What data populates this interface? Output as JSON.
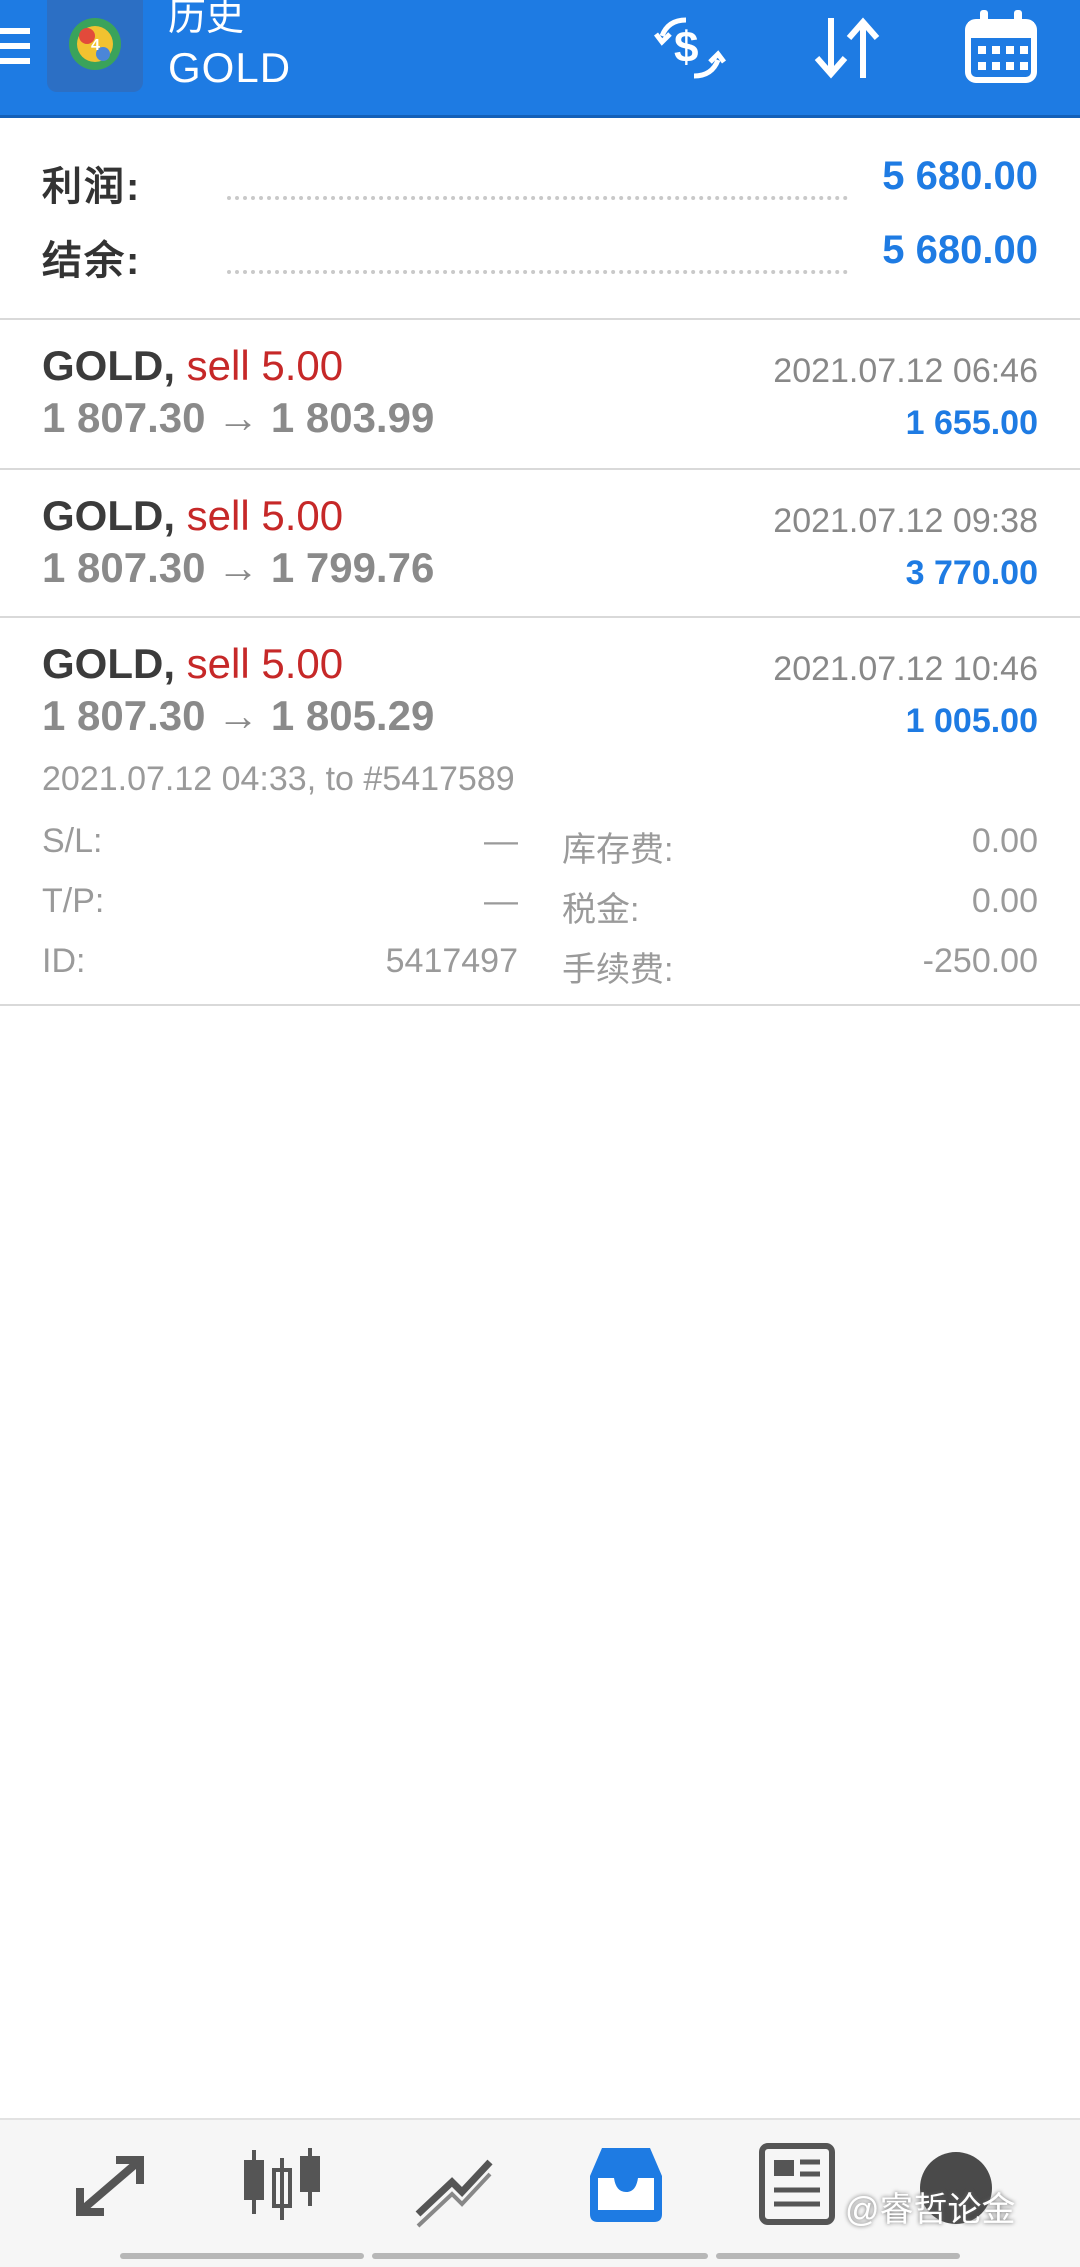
{
  "app_bar": {
    "title": "历史",
    "subtitle": "GOLD",
    "icons": [
      "menu-icon",
      "metatrader-logo-icon",
      "currency-exchange-icon",
      "sort-icon",
      "calendar-icon"
    ]
  },
  "summary": {
    "profit_label": "利润:",
    "profit_value": "5 680.00",
    "balance_label": "结余:",
    "balance_value": "5 680.00"
  },
  "trades": [
    {
      "symbol": "GOLD,",
      "side": "sell 5.00",
      "prices": "1 807.30 → 1 803.99",
      "time": "2021.07.12 06:46",
      "profit": "1 655.00"
    },
    {
      "symbol": "GOLD,",
      "side": "sell 5.00",
      "prices": "1 807.30 → 1 799.76",
      "time": "2021.07.12 09:38",
      "profit": "3 770.00"
    },
    {
      "symbol": "GOLD,",
      "side": "sell 5.00",
      "prices": "1 807.30 → 1 805.29",
      "time": "2021.07.12 10:46",
      "profit": "1 005.00",
      "details": {
        "open_info": "2021.07.12 04:33, to #5417589",
        "sl_label": "S/L:",
        "sl_value": "—",
        "swap_label": "库存费:",
        "swap_value": "0.00",
        "tp_label": "T/P:",
        "tp_value": "—",
        "tax_label": "税金:",
        "tax_value": "0.00",
        "id_label": "ID:",
        "id_value": "5417497",
        "commission_label": "手续费:",
        "commission_value": "-250.00"
      }
    }
  ],
  "bottom_nav": {
    "items": [
      "quotes-icon",
      "chart-candles-icon",
      "trade-icon",
      "history-icon",
      "news-icon"
    ],
    "active": "history-icon",
    "watermark": "@睿哲论金"
  },
  "colors": {
    "app_bar": "#1e7be3",
    "accent_blue": "#1e7be3",
    "sell_red": "#c62828"
  }
}
